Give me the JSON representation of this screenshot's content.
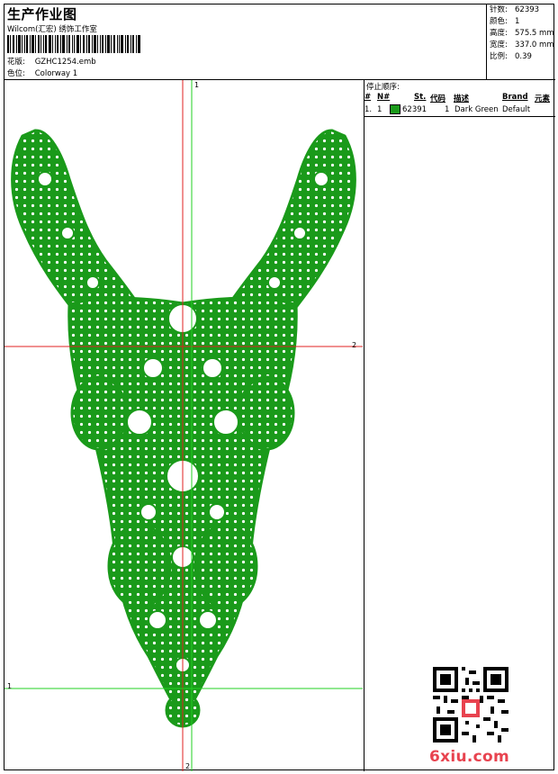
{
  "header": {
    "title": "生产作业图",
    "company": "Wilcom(汇宏) 绣饰工作室",
    "design_label": "花版:",
    "design_value": "GZHC1254.emb",
    "colorway_label": "色位:",
    "colorway_value": "Colorway 1"
  },
  "stats": [
    {
      "label": "针数:",
      "value": "62393"
    },
    {
      "label": "颜色:",
      "value": "1"
    },
    {
      "label": "高度:",
      "value": "575.5 mm"
    },
    {
      "label": "宽度:",
      "value": "337.0 mm"
    },
    {
      "label": "比例:",
      "value": "0.39"
    }
  ],
  "stop_sequence": {
    "title": "停止顺序:",
    "columns": [
      "#",
      "N#",
      "St.",
      "代码",
      "描述",
      "Brand",
      "元素"
    ],
    "rows": [
      {
        "index": "1.",
        "n": "1",
        "stitches": "62391",
        "code": "1",
        "description": "Dark Green",
        "brand": "Default",
        "element": "",
        "color": "#1a9a1a"
      }
    ]
  },
  "guides": {
    "red_top": "1",
    "red_right": "2",
    "green_left": "1",
    "green_bottom": "2"
  },
  "design_color": "#1a9a1a",
  "watermark": "6xiu.com"
}
